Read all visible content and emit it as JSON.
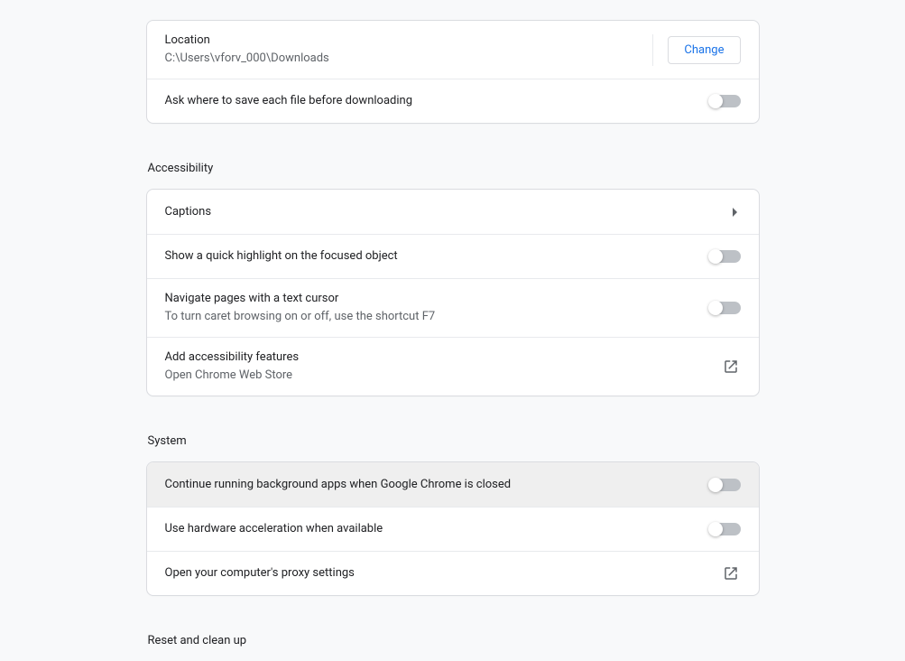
{
  "downloads": {
    "location_label": "Location",
    "location_value": "C:\\Users\\vforv_000\\Downloads",
    "change_label": "Change",
    "ask_label": "Ask where to save each file before downloading"
  },
  "accessibility": {
    "header": "Accessibility",
    "captions_label": "Captions",
    "highlight_label": "Show a quick highlight on the focused object",
    "caret_label": "Navigate pages with a text cursor",
    "caret_sub": "To turn caret browsing on or off, use the shortcut F7",
    "add_label": "Add accessibility features",
    "add_sub": "Open Chrome Web Store"
  },
  "system": {
    "header": "System",
    "bg_label": "Continue running background apps when Google Chrome is closed",
    "hw_label": "Use hardware acceleration when available",
    "proxy_label": "Open your computer's proxy settings"
  },
  "reset": {
    "header": "Reset and clean up"
  }
}
